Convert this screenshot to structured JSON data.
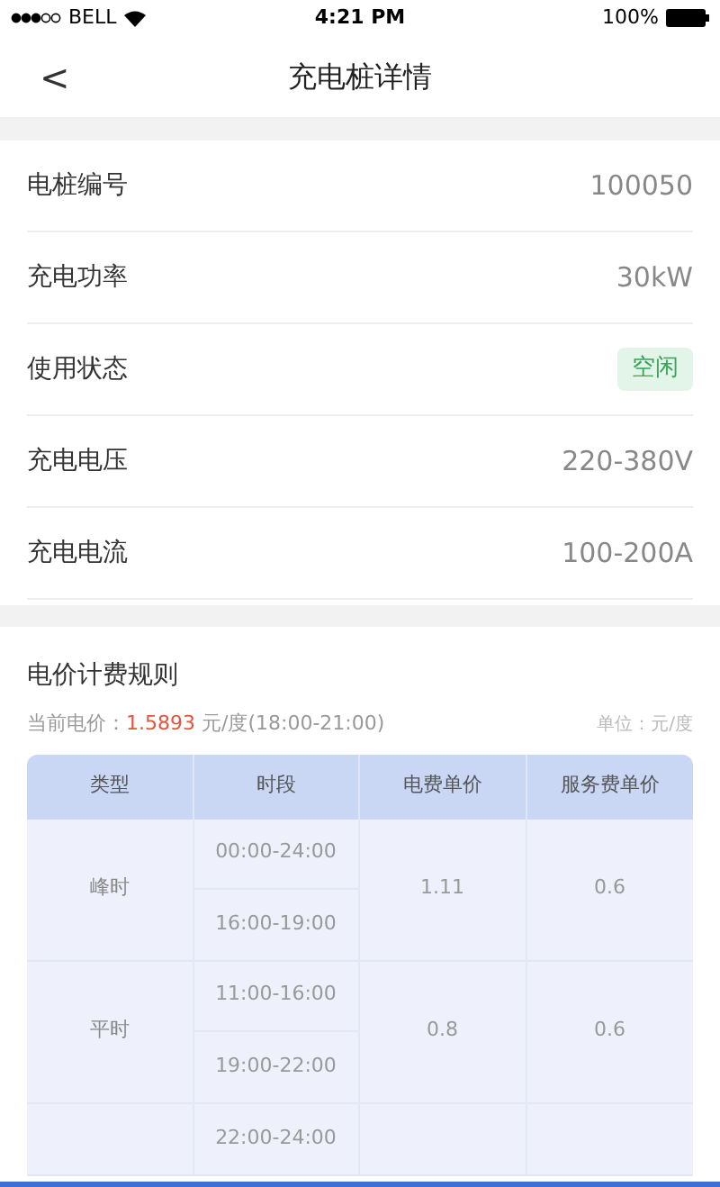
{
  "status_bar": {
    "carrier": "BELL",
    "time": "4:21 PM",
    "battery": "100%"
  },
  "nav": {
    "back": "<",
    "title": "充电桩详情"
  },
  "details": [
    {
      "label": "电桩编号",
      "value": "100050",
      "kind": "text"
    },
    {
      "label": "充电功率",
      "value": "30kW",
      "kind": "text"
    },
    {
      "label": "使用状态",
      "value": "空闲",
      "kind": "badge"
    },
    {
      "label": "充电电压",
      "value": "220-380V",
      "kind": "text"
    },
    {
      "label": "充电电流",
      "value": "100-200A",
      "kind": "text"
    }
  ],
  "pricing": {
    "title": "电价计费规则",
    "current_label": "当前电价：",
    "current_price": "1.5893",
    "current_suffix": " 元/度(18:00-21:00)",
    "unit": "单位：元/度",
    "columns": [
      "类型",
      "时段",
      "电费单价",
      "服务费单价"
    ],
    "groups": [
      {
        "type": "峰时",
        "times": [
          "00:00-24:00",
          "16:00-19:00"
        ],
        "price": "1.11",
        "service": "0.6"
      },
      {
        "type": "平时",
        "times": [
          "11:00-16:00",
          "19:00-22:00"
        ],
        "price": "0.8",
        "service": "0.6"
      },
      {
        "times": [
          "22:00-24:00"
        ]
      }
    ]
  }
}
